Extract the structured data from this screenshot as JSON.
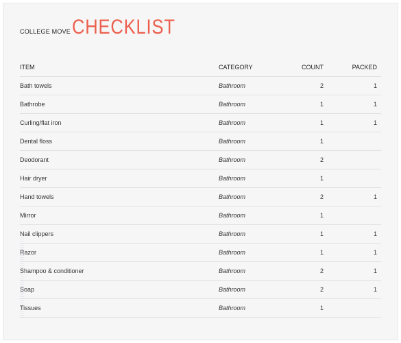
{
  "subtitle": "COLLEGE MOVE",
  "title": "CHECKLIST",
  "headers": {
    "item": "ITEM",
    "category": "CATEGORY",
    "count": "COUNT",
    "packed": "PACKED"
  },
  "rows": [
    {
      "item": "Bath towels",
      "category": "Bathroom",
      "count": "2",
      "packed": "1"
    },
    {
      "item": "Bathrobe",
      "category": "Bathroom",
      "count": "1",
      "packed": "1"
    },
    {
      "item": "Curling/flat iron",
      "category": "Bathroom",
      "count": "1",
      "packed": "1"
    },
    {
      "item": "Dental floss",
      "category": "Bathroom",
      "count": "1",
      "packed": ""
    },
    {
      "item": "Deodorant",
      "category": "Bathroom",
      "count": "2",
      "packed": ""
    },
    {
      "item": "Hair dryer",
      "category": "Bathroom",
      "count": "1",
      "packed": ""
    },
    {
      "item": "Hand towels",
      "category": "Bathroom",
      "count": "2",
      "packed": "1"
    },
    {
      "item": "Mirror",
      "category": "Bathroom",
      "count": "1",
      "packed": ""
    },
    {
      "item": "Nail clippers",
      "category": "Bathroom",
      "count": "1",
      "packed": "1"
    },
    {
      "item": "Razor",
      "category": "Bathroom",
      "count": "1",
      "packed": "1"
    },
    {
      "item": "Shampoo & conditioner",
      "category": "Bathroom",
      "count": "2",
      "packed": "1"
    },
    {
      "item": "Soap",
      "category": "Bathroom",
      "count": "2",
      "packed": "1"
    },
    {
      "item": "Tissues",
      "category": "Bathroom",
      "count": "1",
      "packed": ""
    }
  ]
}
